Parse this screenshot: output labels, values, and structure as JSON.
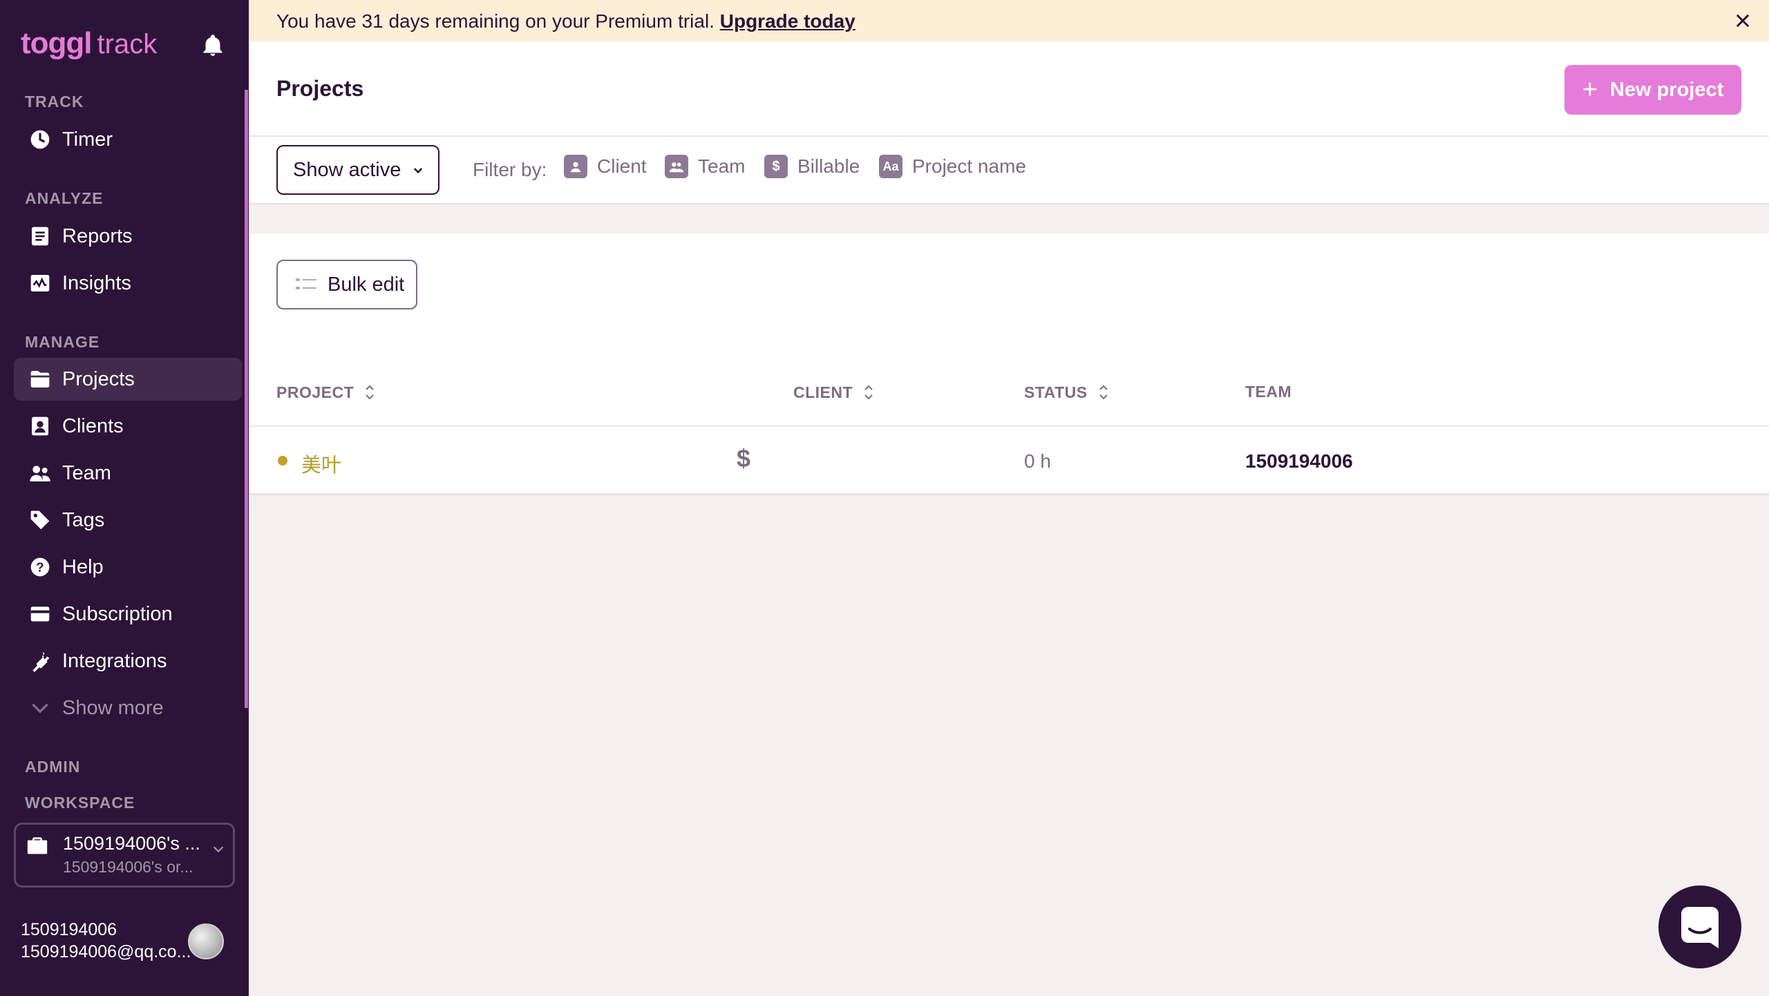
{
  "app": {
    "logo_primary": "toggl",
    "logo_secondary": "track"
  },
  "banner": {
    "text": "You have 31 days remaining on your Premium trial.",
    "link": "Upgrade today"
  },
  "sidebar": {
    "sections": {
      "track": "TRACK",
      "analyze": "ANALYZE",
      "manage": "MANAGE",
      "admin": "ADMIN",
      "workspace": "WORKSPACE"
    },
    "items": {
      "timer": "Timer",
      "reports": "Reports",
      "insights": "Insights",
      "projects": "Projects",
      "clients": "Clients",
      "team": "Team",
      "tags": "Tags",
      "help": "Help",
      "subscription": "Subscription",
      "integrations": "Integrations",
      "show_more": "Show more"
    },
    "active_item": "Projects",
    "workspace": {
      "name": "1509194006's ...",
      "org": "1509194006's or..."
    },
    "user": {
      "id": "1509194006",
      "email": "1509194006@qq.co..."
    }
  },
  "header": {
    "title": "Projects",
    "new_project": "New project"
  },
  "filters": {
    "show_select": "Show active",
    "label": "Filter by:",
    "client": "Client",
    "team": "Team",
    "billable": "Billable",
    "project_name": "Project name",
    "project_name_icon": "Aa"
  },
  "toolbar": {
    "bulk_edit": "Bulk edit"
  },
  "table": {
    "columns": {
      "project": "PROJECT",
      "client": "CLIENT",
      "status": "STATUS",
      "team": "TEAM"
    },
    "rows": [
      {
        "project": "美叶",
        "billable": "$",
        "client": "",
        "status": "0 h",
        "team": "1509194006",
        "color": "#bfa12c"
      }
    ]
  },
  "colors": {
    "sidebar_bg": "#2c1338",
    "accent": "#e57cd8",
    "banner_bg": "#fcefd6"
  }
}
